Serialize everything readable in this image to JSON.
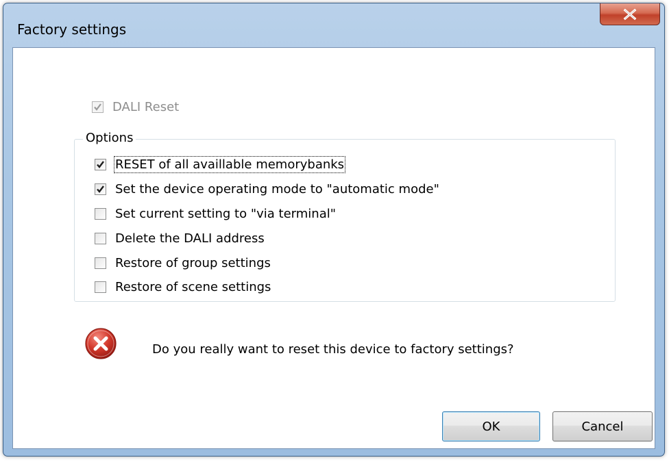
{
  "window": {
    "title": "Factory settings"
  },
  "dali_reset": {
    "label": "DALI Reset",
    "checked": true,
    "enabled": false
  },
  "options": {
    "legend": "Options",
    "items": [
      {
        "label": "RESET of all availlable memorybanks",
        "checked": true
      },
      {
        "label": "Set the device operating mode to \"automatic mode\"",
        "checked": true
      },
      {
        "label": "Set current setting to \"via terminal\"",
        "checked": false
      },
      {
        "label": "Delete the DALI address",
        "checked": false
      },
      {
        "label": "Restore of group settings",
        "checked": false
      },
      {
        "label": "Restore of scene settings",
        "checked": false
      }
    ]
  },
  "message": {
    "text": "Do you really want to reset this device to factory settings?",
    "icon": "error-icon"
  },
  "buttons": {
    "ok_label": "OK",
    "cancel_label": "Cancel"
  },
  "colors": {
    "title_bar": "#a8c6e4",
    "close_button": "#c0412a",
    "error_icon": "#c8302a"
  }
}
